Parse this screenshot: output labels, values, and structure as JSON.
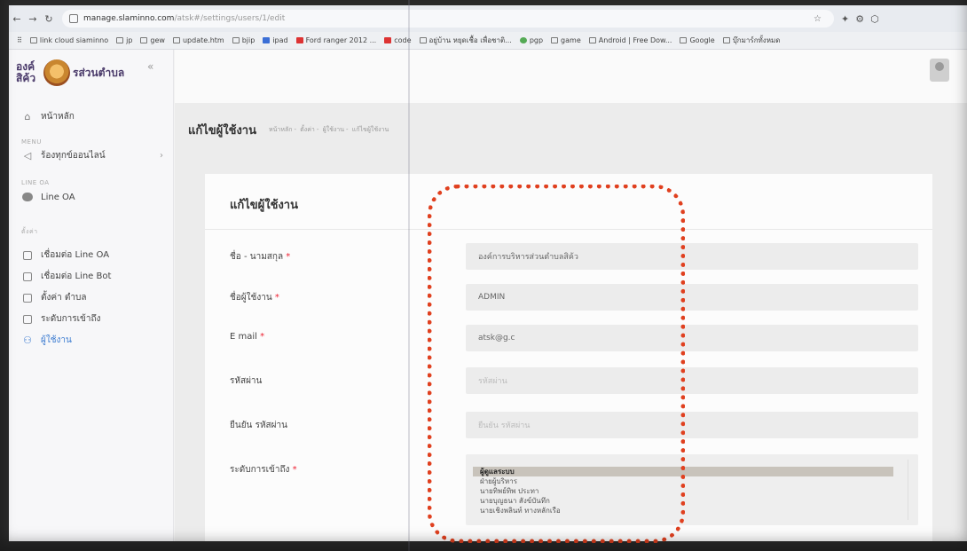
{
  "browser": {
    "url_domain": "manage.slaminno.com",
    "url_path": "/atsk#/settings/users/1/edit",
    "bookmarks": [
      {
        "label": "link cloud siaminno",
        "style": "folder"
      },
      {
        "label": "jp",
        "style": "folder"
      },
      {
        "label": "gew",
        "style": "folder"
      },
      {
        "label": "update.htm",
        "style": "folder"
      },
      {
        "label": "bjip",
        "style": "folder"
      },
      {
        "label": "ipad",
        "style": "blue"
      },
      {
        "label": "Ford ranger 2012 ...",
        "style": "red"
      },
      {
        "label": "code",
        "style": "red"
      },
      {
        "label": "อยู่บ้าน หยุดเชื้อ เพื่อชาติ...",
        "style": "folder"
      },
      {
        "label": "pgp",
        "style": "green"
      },
      {
        "label": "game",
        "style": "folder"
      },
      {
        "label": "Android | Free Dow...",
        "style": "folder"
      },
      {
        "label": "Google",
        "style": "folder"
      },
      {
        "label": "บุ๊กมาร์กทั้งหมด",
        "style": "folder"
      }
    ]
  },
  "sidebar": {
    "brand_line1": "องค์การบริหารส่วนตำบล",
    "brand_short_a": "องค์",
    "brand_short_b": "สิค้ว",
    "brand_right": "รส่วนตำบล",
    "home": "หน้าหลัก",
    "section_menu": "MENU",
    "menu_item": "ร้องทุกข์ออนไลน์",
    "section_line": "LINE OA",
    "line_oa": "Line OA",
    "section_settings": "ตั้งค่า",
    "items": [
      {
        "label": "เชื่อมต่อ Line OA"
      },
      {
        "label": "เชื่อมต่อ Line Bot"
      },
      {
        "label": "ตั้งค่า ตำบล"
      },
      {
        "label": "ระดับการเข้าถึง"
      },
      {
        "label": "ผู้ใช้งาน"
      }
    ]
  },
  "page": {
    "title": "แก้ไขผู้ใช้งาน",
    "breadcrumb": [
      "หน้าหลัก",
      "ตั้งค่า",
      "ผู้ใช้งาน",
      "แก้ไขผู้ใช้งาน"
    ]
  },
  "form": {
    "card_title": "แก้ไขผู้ใช้งาน",
    "name_label": "ชื่อ - นามสกุล",
    "name_value": "องค์การบริหารส่วนตำบลสิค้ว",
    "username_label": "ชื่อผู้ใช้งาน",
    "username_value": "ADMIN",
    "email_label": "E mail",
    "email_value": "atsk@g.c",
    "password_label": "รหัสผ่าน",
    "password_placeholder": "รหัสผ่าน",
    "confirm_label": "ยืนยัน รหัสผ่าน",
    "confirm_placeholder": "ยืนยัน รหัสผ่าน",
    "access_label": "ระดับการเข้าถึง",
    "required_mark": "*",
    "access_options": [
      "ผู้ดูแลระบบ",
      "ฝ่ายผู้บริหาร",
      "นายทิพย์ทิพ ประทา",
      "นายบุญธนา สังข์บันทึก",
      "นายเชิงพลินท์ ทางหลักเรือ"
    ],
    "access_selected": "ผู้ดูแลระบบ"
  },
  "colors": {
    "highlight": "#e0401f",
    "accent": "#3b7bd0"
  }
}
